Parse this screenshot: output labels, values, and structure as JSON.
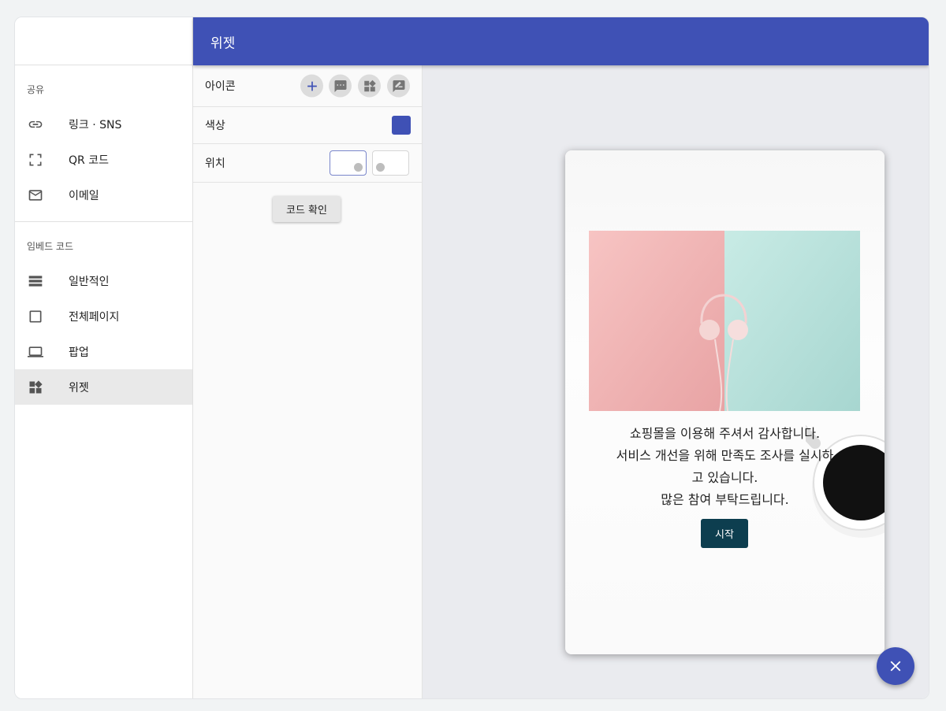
{
  "sidebar": {
    "share_title": "공유",
    "share_items": [
      {
        "label": "링크 · SNS",
        "icon": "link-icon"
      },
      {
        "label": "QR 코드",
        "icon": "qr-scan-icon"
      },
      {
        "label": "이메일",
        "icon": "mail-icon"
      }
    ],
    "embed_title": "임베드 코드",
    "embed_items": [
      {
        "label": "일반적인",
        "icon": "layout-list-icon"
      },
      {
        "label": "전체페이지",
        "icon": "square-icon"
      },
      {
        "label": "팝업",
        "icon": "laptop-icon"
      },
      {
        "label": "위젯",
        "icon": "widgets-icon",
        "active": true
      }
    ]
  },
  "header": {
    "title": "위젯"
  },
  "settings": {
    "icon_label": "아이콘",
    "icon_options": [
      "add-icon",
      "chat-bubble-icon",
      "widgets-icon",
      "edit-note-icon"
    ],
    "color_label": "색상",
    "color_value": "#3f51b5",
    "position_label": "위치",
    "position_options": [
      "bottom-right",
      "bottom-left"
    ],
    "position_selected": "bottom-right",
    "code_button": "코드 확인"
  },
  "preview": {
    "message_lines": [
      "쇼핑몰을 이용해 주셔서 감사합니다.",
      "서비스 개선을 위해 만족도 조사를 실시하",
      "고 있습니다.",
      "많은 참여 부탁드립니다."
    ],
    "start_button": "시작",
    "button_color": "#0d3e4f"
  },
  "fab": {
    "icon": "close-icon"
  },
  "colors": {
    "primary": "#3f51b5",
    "background": "#f1f3f4"
  }
}
